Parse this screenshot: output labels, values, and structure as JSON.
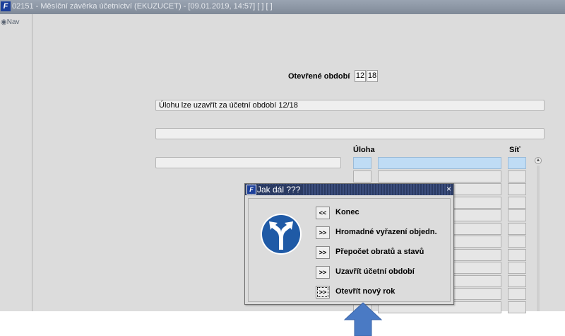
{
  "window": {
    "title": "02151 - Měsíční závěrka účetnictví (EKUZUCET) - [09.01.2019, 14:57]  [ ] [ ]"
  },
  "nav": {
    "label": "Nav"
  },
  "form": {
    "period_label": "Otevřené období",
    "period_month": "12",
    "period_year": "18",
    "status_message": "Úlohu lze uzavřít za účetní období 12/18",
    "col_task": "Úloha",
    "col_net": "Síť"
  },
  "dialog": {
    "title": "Jak dál ???",
    "close": "×",
    "actions": [
      {
        "button": "<<",
        "label": "Konec"
      },
      {
        "button": ">>",
        "label": "Hromadné vyřazení objedn."
      },
      {
        "button": ">>",
        "label": "Přepočet obratů a stavů"
      },
      {
        "button": ">>",
        "label": "Uzavřít účetní období"
      },
      {
        "button": ">>",
        "label": "Otevřít nový rok"
      }
    ]
  },
  "colors": {
    "accent_blue": "#1f5aa6",
    "arrow_blue": "#4a7ac4",
    "grid_blue": "#bfdcf5"
  },
  "icons": [
    "app-logo-icon",
    "nav-icon",
    "direction-sign-icon",
    "scroll-up-icon",
    "close-icon",
    "down-arrow-icon"
  ]
}
